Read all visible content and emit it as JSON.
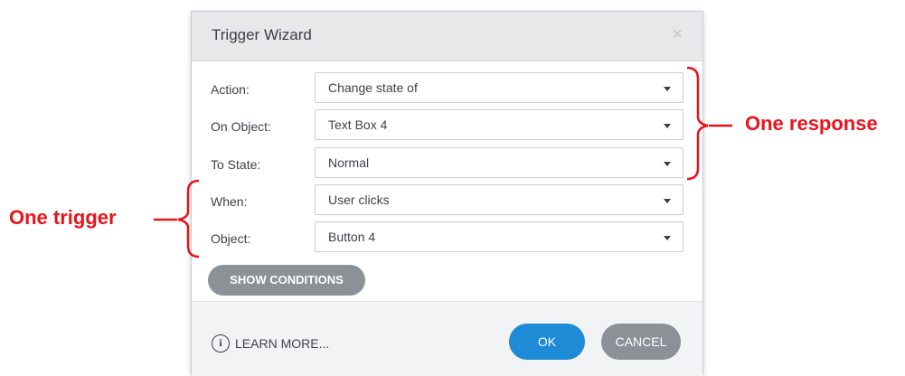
{
  "dialog": {
    "title": "Trigger Wizard",
    "close_glyph": "×",
    "fields": [
      {
        "label": "Action:",
        "value": "Change state of"
      },
      {
        "label": "On Object:",
        "value": "Text Box 4"
      },
      {
        "label": "To State:",
        "value": "Normal"
      },
      {
        "label": "When:",
        "value": "User clicks"
      },
      {
        "label": "Object:",
        "value": "Button 4"
      }
    ],
    "show_conditions_label": "SHOW CONDITIONS",
    "footer": {
      "info_glyph": "i",
      "learn_more_label": "LEARN MORE...",
      "ok_label": "OK",
      "cancel_label": "CANCEL"
    }
  },
  "annotations": {
    "response_label": "One response",
    "trigger_label": "One trigger",
    "color": "#e8131b"
  },
  "colors": {
    "header_bg": "#e6e8ea",
    "primary_button": "#1d8bd6",
    "secondary_button": "#8b9196",
    "footer_bg": "#f2f3f4"
  }
}
